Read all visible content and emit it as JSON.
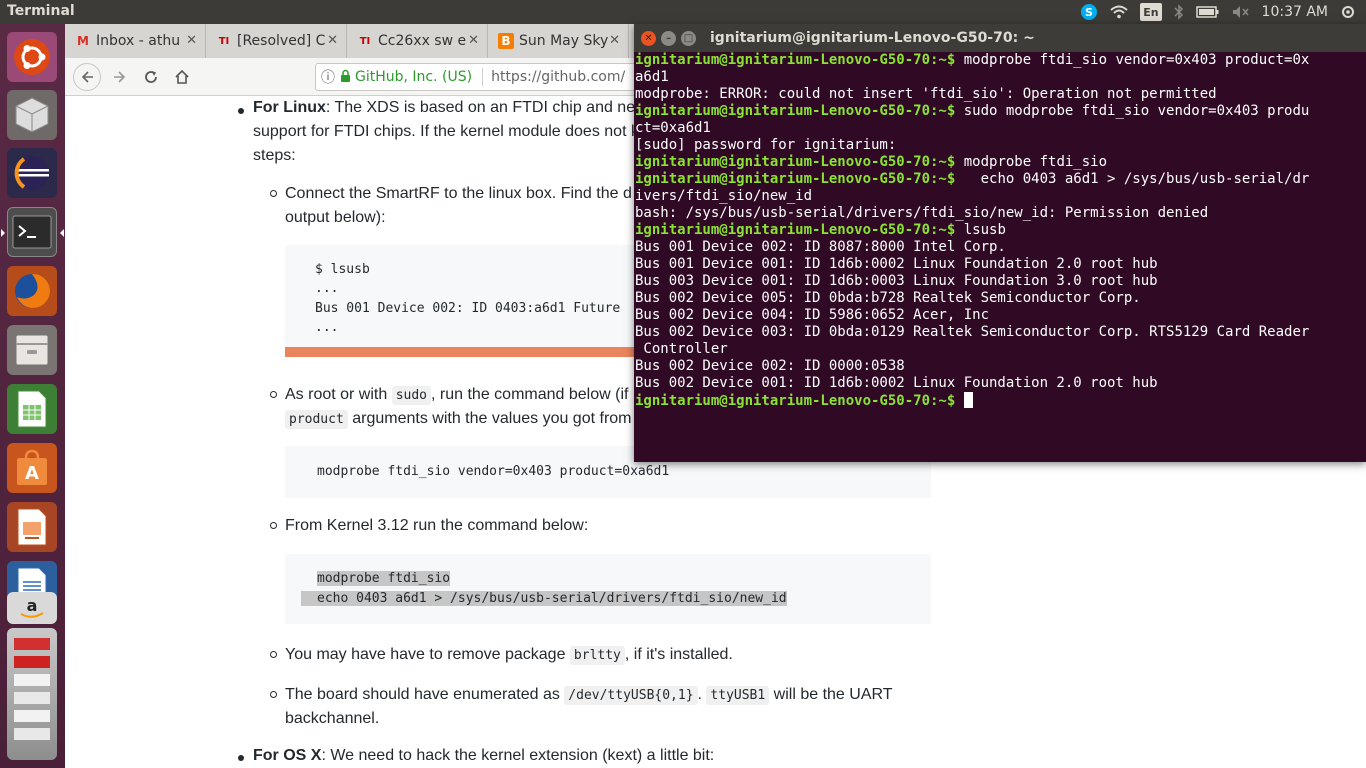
{
  "panel": {
    "app_title": "Terminal",
    "keyboard": "En",
    "clock": "10:37 AM"
  },
  "launcher": {
    "items": [
      "ubuntu-dash",
      "cube-app",
      "eclipse",
      "terminal",
      "firefox",
      "file-manager",
      "libreoffice-calc",
      "software-center",
      "libreoffice-impress",
      "libreoffice-writer",
      "amazon",
      "stacked-apps"
    ]
  },
  "browser": {
    "tabs": [
      {
        "label": "Inbox - athu",
        "favicon": "M"
      },
      {
        "label": "[Resolved] C",
        "favicon": "TI"
      },
      {
        "label": "Cc26xx sw e",
        "favicon": "TI"
      },
      {
        "label": "Sun May Sky",
        "favicon": "B"
      }
    ],
    "url_org": "GitHub, Inc. (US)",
    "url": "https://github.com/",
    "content": {
      "linux_heading": "For Linux",
      "linux_text_1": ": The XDS is based on an FTDI chip and ne",
      "linux_text_2": "support for FTDI chips. If the kernel module does not k",
      "linux_text_3": "steps:",
      "step1_text_1": "Connect the SmartRF to the linux box. Find the d",
      "step1_text_2": "output below):",
      "lsusb_code": [
        "$ lsusb",
        "...",
        "Bus 001 Device 002: ID 0403:a6d1 Future",
        "..."
      ],
      "step2_text_1": "As root or with ",
      "step2_code_sudo": "sudo",
      "step2_text_2": ", run the command below (if",
      "step2_code_product": "product",
      "step2_text_3": " arguments with the values you got from",
      "modprobe_code": "modprobe ftdi_sio vendor=0x403 product=0xa6d1",
      "step3_text": "From Kernel 3.12 run the command below:",
      "kernel_code_1": "modprobe ftdi_sio",
      "kernel_code_2": "echo 0403 a6d1 > /sys/bus/usb-serial/drivers/ftdi_sio/new_id",
      "step4_text_1": "You may have have to remove package ",
      "step4_code": "brltty",
      "step4_text_2": ", if it's installed.",
      "step5_text_1": "The board should have enumerated as ",
      "step5_code_1": "/dev/ttyUSB{0,1}",
      "step5_text_2": ". ",
      "step5_code_2": "ttyUSB1",
      "step5_text_3": " will be the UART",
      "step5_text_4": "backchannel.",
      "osx_heading": "For OS X",
      "osx_text": ": We need to hack the kernel extension (kext) a little bit:"
    }
  },
  "terminal": {
    "title": "ignitarium@ignitarium-Lenovo-G50-70: ~",
    "prompt": "ignitarium@ignitarium-Lenovo-G50-70:~$",
    "lines": [
      {
        "prompt": true,
        "text": " modprobe ftdi_sio vendor=0x403 product=0x"
      },
      {
        "prompt": false,
        "text": "a6d1"
      },
      {
        "prompt": false,
        "text": "modprobe: ERROR: could not insert 'ftdi_sio': Operation not permitted"
      },
      {
        "prompt": true,
        "text": " sudo modprobe ftdi_sio vendor=0x403 produ"
      },
      {
        "prompt": false,
        "text": "ct=0xa6d1"
      },
      {
        "prompt": false,
        "text": "[sudo] password for ignitarium:"
      },
      {
        "prompt": true,
        "text": " modprobe ftdi_sio"
      },
      {
        "prompt": true,
        "text": "   echo 0403 a6d1 > /sys/bus/usb-serial/dr"
      },
      {
        "prompt": false,
        "text": "ivers/ftdi_sio/new_id"
      },
      {
        "prompt": false,
        "text": "bash: /sys/bus/usb-serial/drivers/ftdi_sio/new_id: Permission denied"
      },
      {
        "prompt": true,
        "text": " lsusb"
      },
      {
        "prompt": false,
        "text": "Bus 001 Device 002: ID 8087:8000 Intel Corp."
      },
      {
        "prompt": false,
        "text": "Bus 001 Device 001: ID 1d6b:0002 Linux Foundation 2.0 root hub"
      },
      {
        "prompt": false,
        "text": "Bus 003 Device 001: ID 1d6b:0003 Linux Foundation 3.0 root hub"
      },
      {
        "prompt": false,
        "text": "Bus 002 Device 005: ID 0bda:b728 Realtek Semiconductor Corp."
      },
      {
        "prompt": false,
        "text": "Bus 002 Device 004: ID 5986:0652 Acer, Inc"
      },
      {
        "prompt": false,
        "text": "Bus 002 Device 003: ID 0bda:0129 Realtek Semiconductor Corp. RTS5129 Card Reader"
      },
      {
        "prompt": false,
        "text": " Controller"
      },
      {
        "prompt": false,
        "text": "Bus 002 Device 002: ID 0000:0538"
      },
      {
        "prompt": false,
        "text": "Bus 002 Device 001: ID 1d6b:0002 Linux Foundation 2.0 root hub"
      },
      {
        "prompt": true,
        "text": " ",
        "cursor": true
      }
    ]
  }
}
